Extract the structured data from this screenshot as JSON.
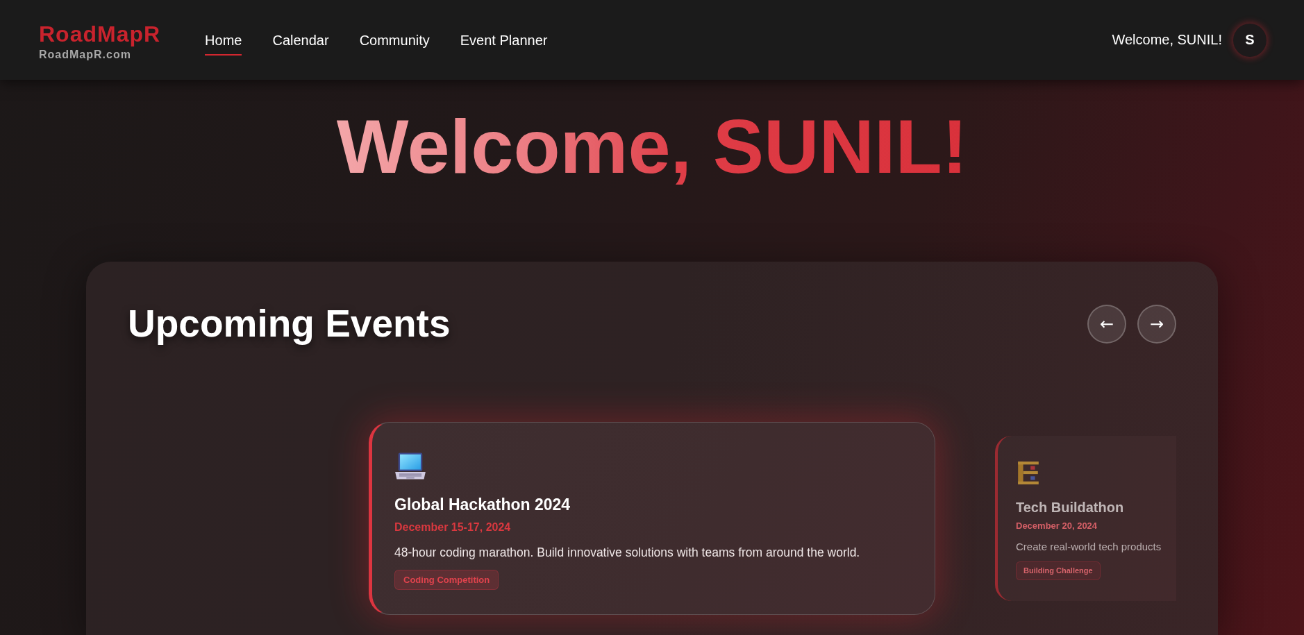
{
  "header": {
    "logo": {
      "title": "RoadMapR",
      "subtitle": "RoadMapR.com"
    },
    "nav": [
      {
        "label": "Home",
        "selected": true
      },
      {
        "label": "Calendar",
        "selected": false
      },
      {
        "label": "Community",
        "selected": false
      },
      {
        "label": "Event Planner",
        "selected": false
      }
    ],
    "greeting": "Welcome, SUNIL!",
    "avatar": {
      "initial": "S"
    }
  },
  "hero": {
    "title": "Welcome, SUNIL!"
  },
  "events": {
    "title": "Upcoming Events",
    "prev_button": "←",
    "next_button": "→",
    "cards": [
      {
        "selected": true,
        "title": "Global Hackathon 2024",
        "date": "December 15-17, 2024",
        "description": "48-hour coding marathon. Build innovative solutions with teams from around the world.",
        "tag": "Coding Competition"
      },
      {
        "selected": false,
        "title": "Tech Buildathon",
        "date": "December 20, 2024",
        "description": "Create real-world tech products",
        "tag": "Building Challenge"
      }
    ]
  }
}
